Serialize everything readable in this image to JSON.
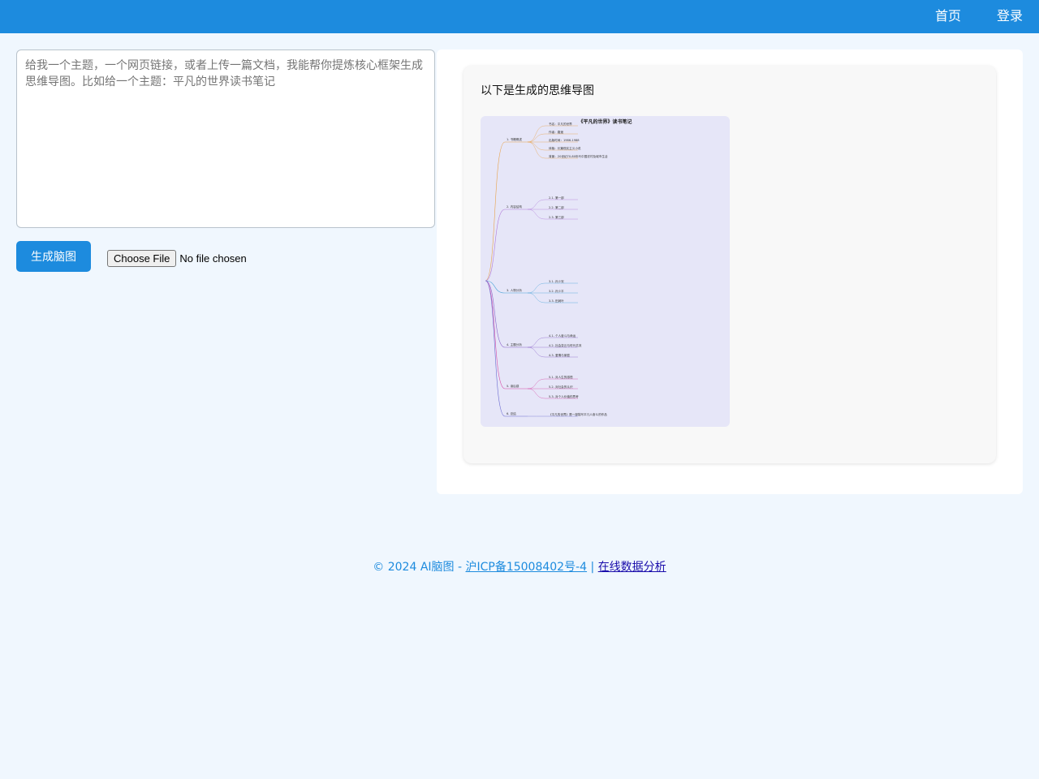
{
  "nav": {
    "home_label": "首页",
    "login_label": "登录"
  },
  "input": {
    "placeholder": "给我一个主题，一个网页链接，或者上传一篇文档，我能帮你提炼核心框架生成思维导图。比如给一个主题：平凡的世界读书笔记",
    "value": ""
  },
  "actions": {
    "generate_label": "生成脑图",
    "file_button_label": "Choose File",
    "file_status": "No file chosen"
  },
  "result": {
    "title": "以下是生成的思维导图",
    "mindmap": {
      "root": "《平凡的世界》读书笔记",
      "branches": [
        {
          "label": "1. 书籍概述",
          "children": [
            "书名：平凡的世界",
            "作者：路遥",
            "出版时间：1986-1988",
            "体裁：长篇现实主义小说",
            "背景：20世纪70-80年代中国农村及城市生活"
          ]
        },
        {
          "label": "2. 内容结构",
          "children": [
            "2.1. 第一部",
            "2.2. 第二部",
            "2.3. 第三部"
          ]
        },
        {
          "label": "3. 人物分析",
          "children": [
            "3.1. 孙少安",
            "3.2. 孙少平",
            "3.3. 田润叶"
          ]
        },
        {
          "label": "4. 主题分析",
          "children": [
            "4.1. 个人奋斗与命运",
            "4.2. 社会变迁与时代洪流",
            "4.3. 爱情与家庭"
          ]
        },
        {
          "label": "5. 读后感",
          "children": [
            "5.1. 对人生的感悟",
            "5.2. 对社会的认识",
            "5.3. 对个人价值的思考"
          ]
        },
        {
          "label": "6. 总结",
          "children": [
            "《平凡的世界》是一部描写平凡人奋斗的作品"
          ]
        }
      ]
    }
  },
  "footer": {
    "copyright": "© 2024 AI脑图 - ",
    "icp_link": "沪ICP备15008402号-4",
    "separator": " | ",
    "analysis_link": "在线数据分析"
  },
  "colors": {
    "primary": "#1d8bde",
    "page_bg": "#f0f7fe",
    "mindmap_bg": "#e6e6f8"
  }
}
